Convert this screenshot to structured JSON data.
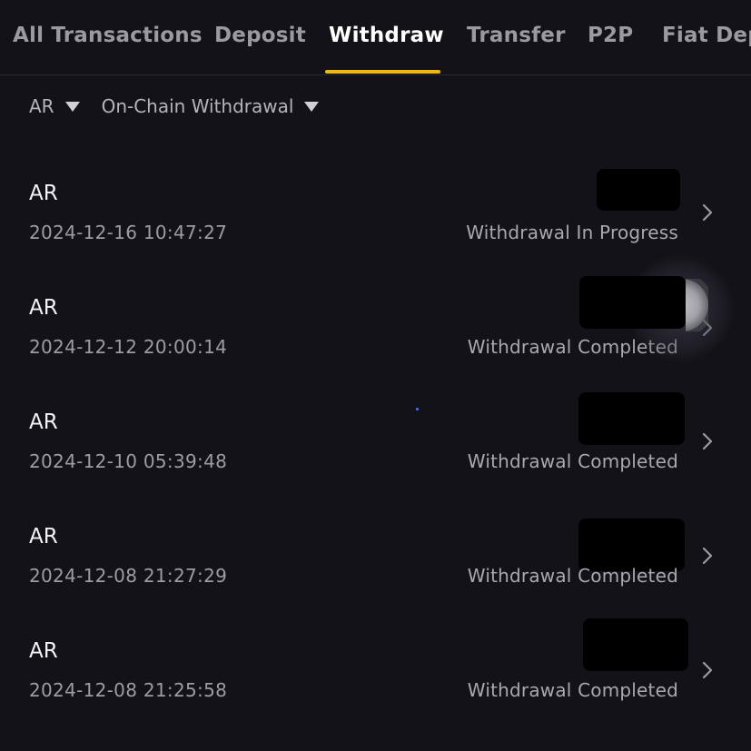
{
  "tabs": [
    {
      "label": "All Transactions",
      "active": false
    },
    {
      "label": "Deposit",
      "active": false
    },
    {
      "label": "Withdraw",
      "active": true
    },
    {
      "label": "Transfer",
      "active": false
    },
    {
      "label": "P2P",
      "active": false
    },
    {
      "label": "Fiat Dep",
      "active": false
    }
  ],
  "filters": {
    "coin": "AR",
    "type": "On-Chain Withdrawal"
  },
  "transactions": [
    {
      "coin": "AR",
      "time": "2024-12-16 10:47:27",
      "status": "Withdrawal In Progress"
    },
    {
      "coin": "AR",
      "time": "2024-12-12 20:00:14",
      "status": "Withdrawal Completed"
    },
    {
      "coin": "AR",
      "time": "2024-12-10 05:39:48",
      "status": "Withdrawal Completed"
    },
    {
      "coin": "AR",
      "time": "2024-12-08 21:27:29",
      "status": "Withdrawal Completed"
    },
    {
      "coin": "AR",
      "time": "2024-12-08 21:25:58",
      "status": "Withdrawal Completed"
    }
  ],
  "colors": {
    "background": "#131219",
    "accent": "#f0b90b",
    "tab_active": "#ffffff",
    "tab_inactive": "#9a9aa2"
  },
  "icons": {
    "filter_caret": "caret-down-icon",
    "row_chevron": "chevron-right-icon"
  }
}
